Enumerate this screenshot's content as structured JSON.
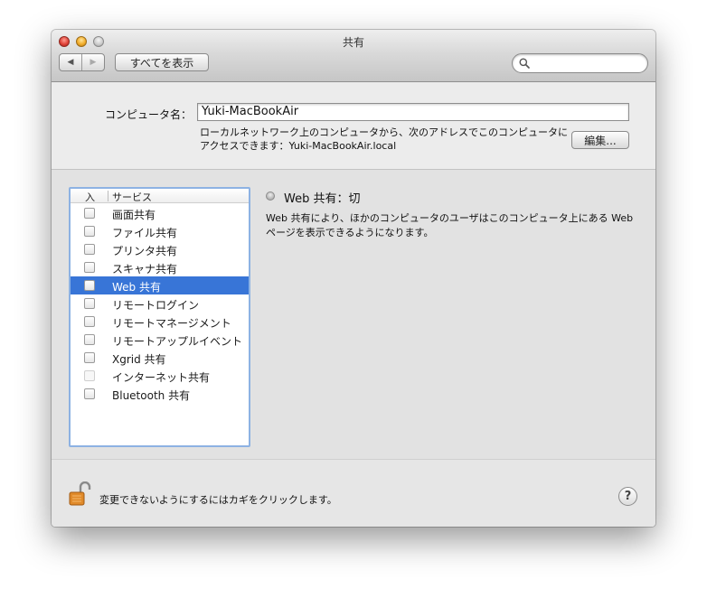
{
  "window": {
    "title": "共有"
  },
  "toolbar": {
    "back_icon": "◀",
    "forward_icon": "▶",
    "show_all_label": "すべてを表示",
    "search_placeholder": "",
    "search_value": ""
  },
  "computer": {
    "label": "コンピュータ名：",
    "name": "Yuki-MacBookAir",
    "description_line1": "ローカルネットワーク上のコンピュータから、次のアドレスでこのコンピュータに",
    "description_line2": "アクセスできます：Yuki-MacBookAir.local",
    "edit_button": "編集..."
  },
  "services": {
    "header_on": "入",
    "header_service": "サービス",
    "items": [
      {
        "label": "画面共有",
        "checked": false,
        "enabled": true,
        "selected": false
      },
      {
        "label": "ファイル共有",
        "checked": false,
        "enabled": true,
        "selected": false
      },
      {
        "label": "プリンタ共有",
        "checked": false,
        "enabled": true,
        "selected": false
      },
      {
        "label": "スキャナ共有",
        "checked": false,
        "enabled": true,
        "selected": false
      },
      {
        "label": "Web 共有",
        "checked": false,
        "enabled": true,
        "selected": true
      },
      {
        "label": "リモートログイン",
        "checked": false,
        "enabled": true,
        "selected": false
      },
      {
        "label": "リモートマネージメント",
        "checked": false,
        "enabled": true,
        "selected": false
      },
      {
        "label": "リモートアップルイベント",
        "checked": false,
        "enabled": true,
        "selected": false
      },
      {
        "label": "Xgrid 共有",
        "checked": false,
        "enabled": true,
        "selected": false
      },
      {
        "label": "インターネット共有",
        "checked": false,
        "enabled": false,
        "selected": false
      },
      {
        "label": "Bluetooth 共有",
        "checked": false,
        "enabled": true,
        "selected": false
      }
    ]
  },
  "detail": {
    "status": "Web 共有：切",
    "status_indicator_color": "#9a9a9a",
    "info_line1": "Web 共有により、ほかのコンピュータのユーザはこのコンピュータ上にある Web",
    "info_line2": "ページを表示できるようになります。"
  },
  "footer": {
    "lock_text": "変更できないようにするにはカギをクリックします。",
    "help_label": "?"
  },
  "colors": {
    "selection": "#3875d7",
    "list_focus_border": "#8db2e3",
    "lock": "#e08a2a"
  }
}
